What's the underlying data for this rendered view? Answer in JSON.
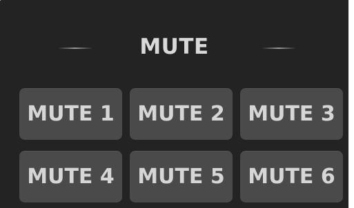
{
  "section": {
    "title": "MUTE"
  },
  "buttons": [
    {
      "label": "MUTE 1"
    },
    {
      "label": "MUTE 2"
    },
    {
      "label": "MUTE 3"
    },
    {
      "label": "MUTE 4"
    },
    {
      "label": "MUTE 5"
    },
    {
      "label": "MUTE 6"
    }
  ],
  "colors": {
    "panel_background": "#232323",
    "button_background": "#4a4a4a",
    "text": "#d6d6d6"
  }
}
